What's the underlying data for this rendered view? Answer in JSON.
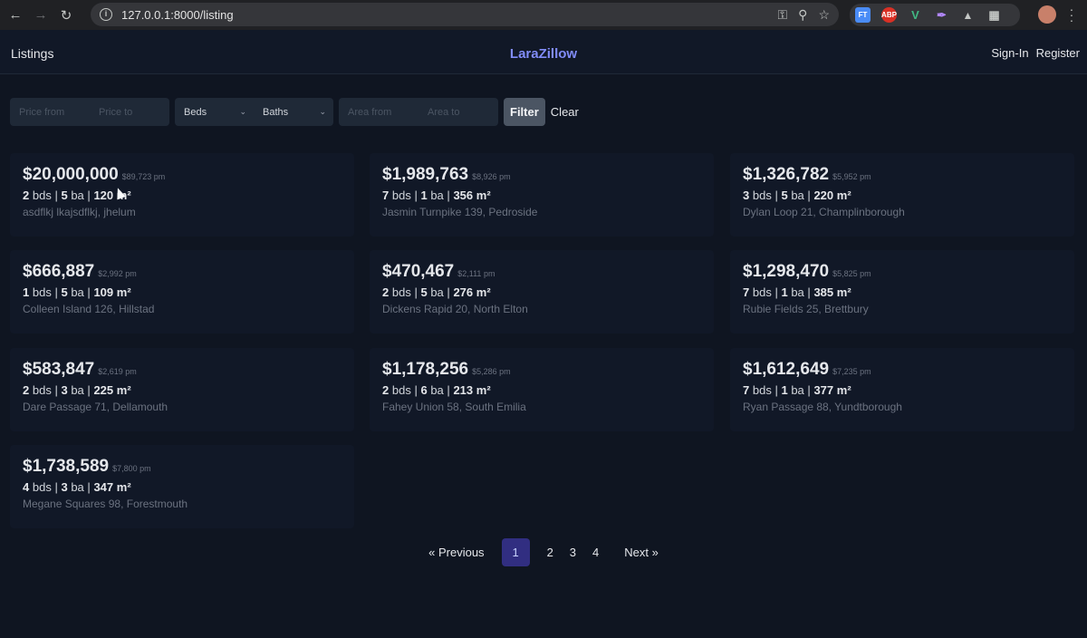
{
  "browser": {
    "url": "127.0.0.1:8000/listing",
    "extensions": [
      "FT",
      "ABP",
      "V"
    ]
  },
  "header": {
    "listings_link": "Listings",
    "brand": "LaraZillow",
    "sign_in": "Sign-In",
    "register": "Register"
  },
  "filters": {
    "price_from_placeholder": "Price from",
    "price_to_placeholder": "Price to",
    "beds_label": "Beds",
    "baths_label": "Baths",
    "area_from_placeholder": "Area from",
    "area_to_placeholder": "Area to",
    "filter_button": "Filter",
    "clear_button": "Clear"
  },
  "listings": [
    {
      "price": "$20,000,000",
      "monthly": "$89,723 pm",
      "beds": "2",
      "baths": "5",
      "area": "120",
      "address": "asdflkj lkajsdflkj, jhelum"
    },
    {
      "price": "$1,989,763",
      "monthly": "$8,926 pm",
      "beds": "7",
      "baths": "1",
      "area": "356",
      "address": "Jasmin Turnpike 139, Pedroside"
    },
    {
      "price": "$1,326,782",
      "monthly": "$5,952 pm",
      "beds": "3",
      "baths": "5",
      "area": "220",
      "address": "Dylan Loop 21, Champlinborough"
    },
    {
      "price": "$666,887",
      "monthly": "$2,992 pm",
      "beds": "1",
      "baths": "5",
      "area": "109",
      "address": "Colleen Island 126, Hillstad"
    },
    {
      "price": "$470,467",
      "monthly": "$2,111 pm",
      "beds": "2",
      "baths": "5",
      "area": "276",
      "address": "Dickens Rapid 20, North Elton"
    },
    {
      "price": "$1,298,470",
      "monthly": "$5,825 pm",
      "beds": "7",
      "baths": "1",
      "area": "385",
      "address": "Rubie Fields 25, Brettbury"
    },
    {
      "price": "$583,847",
      "monthly": "$2,619 pm",
      "beds": "2",
      "baths": "3",
      "area": "225",
      "address": "Dare Passage 71, Dellamouth"
    },
    {
      "price": "$1,178,256",
      "monthly": "$5,286 pm",
      "beds": "2",
      "baths": "6",
      "area": "213",
      "address": "Fahey Union 58, South Emilia"
    },
    {
      "price": "$1,612,649",
      "monthly": "$7,235 pm",
      "beds": "7",
      "baths": "1",
      "area": "377",
      "address": "Ryan Passage 88, Yundtborough"
    },
    {
      "price": "$1,738,589",
      "monthly": "$7,800 pm",
      "beds": "4",
      "baths": "3",
      "area": "347",
      "address": "Megane Squares 98, Forestmouth"
    }
  ],
  "labels": {
    "beds": "bds",
    "baths": "ba",
    "area_unit": "m²",
    "sep": "|"
  },
  "pagination": {
    "previous": "« Previous",
    "pages": [
      "1",
      "2",
      "3",
      "4"
    ],
    "active": "1",
    "next": "Next »"
  }
}
